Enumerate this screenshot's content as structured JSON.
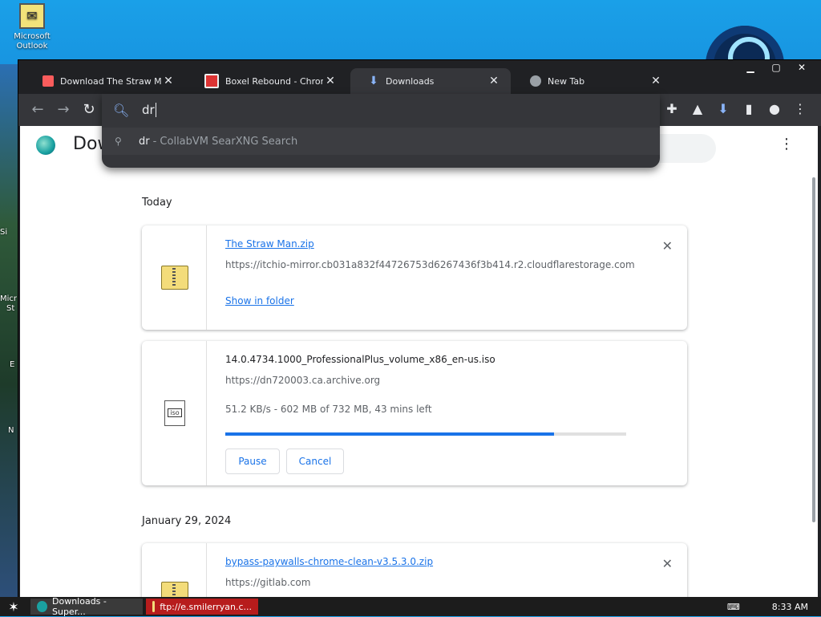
{
  "desktop": {
    "icon_label": "Microsoft Outlook",
    "partial_labels": [
      "Si",
      "Micr",
      "St",
      "E",
      "N"
    ]
  },
  "browser": {
    "tabs": [
      {
        "label": "Download The Straw Man b",
        "icon": "itchio-icon",
        "active": false
      },
      {
        "label": "Boxel Rebound - Chrome W",
        "icon": "game-icon",
        "active": false
      },
      {
        "label": "Downloads",
        "icon": "download-icon",
        "active": true
      },
      {
        "label": "New Tab",
        "icon": "globe-icon",
        "active": false
      }
    ],
    "omnibox": {
      "text": "dr",
      "suggestion_query": "dr",
      "suggestion_rest": "- CollabVM SearXNG Search"
    }
  },
  "page": {
    "title": "Dow",
    "sections": [
      {
        "date": "Today"
      },
      {
        "date": "January 29, 2024"
      }
    ],
    "downloads": [
      {
        "name": "The Straw Man.zip",
        "url": "https://itchio-mirror.cb031a832f44726753d6267436f3b414.r2.cloudflarestorage.com",
        "action": "Show in folder"
      },
      {
        "name": "14.0.4734.1000_ProfessionalPlus_volume_x86_en-us.iso",
        "url": "https://dn720003.ca.archive.org",
        "status": "51.2 KB/s - 602 MB of 732 MB, 43 mins left",
        "progress": 0.82,
        "pause_label": "Pause",
        "cancel_label": "Cancel"
      },
      {
        "name": "bypass-paywalls-chrome-clean-v3.5.3.0.zip",
        "url": "https://gitlab.com"
      }
    ]
  },
  "taskbar": {
    "tasks": [
      "Downloads - Super...",
      "ftp://e.smilerryan.c..."
    ],
    "time": "8:33 AM"
  },
  "colors": {
    "accent": "#1a73e8",
    "tab_active": "#35363a",
    "chrome_dark": "#202124"
  }
}
